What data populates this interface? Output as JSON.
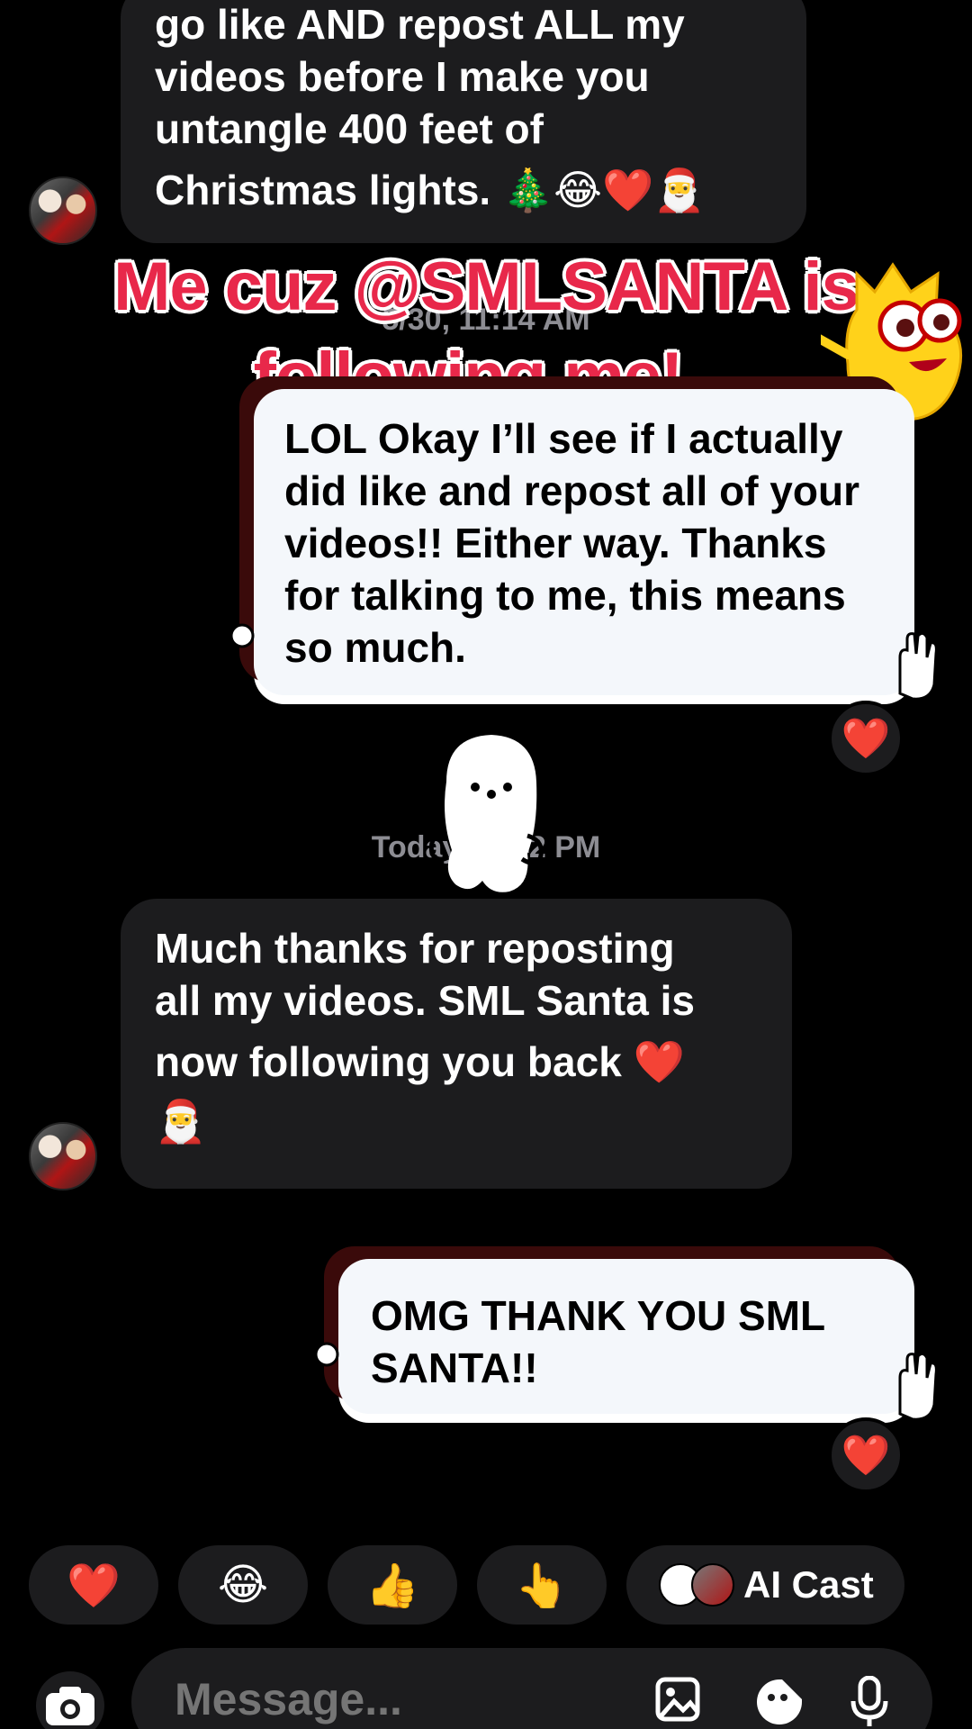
{
  "messages": {
    "msg1_lines": [
      "go like AND repost ALL my",
      "videos before I make you",
      "untangle 400 feet of",
      "Christmas lights. 🎄😂❤️🎅"
    ],
    "timestamp1": "5/30, 11:14 AM",
    "msg2": "LOL Okay I’ll see if I actually did like and repost all of your videos!! Either way. Thanks for talking to me, this means so much.",
    "timestamp2": "Today 12:42 PM",
    "msg3_lines": [
      "Much thanks for reposting",
      "all my videos. SML Santa is",
      "now following you back ❤️",
      "🎅"
    ],
    "msg4": "OMG THANK YOU SML SANTA!!"
  },
  "overlay": {
    "caption_line1": "Me cuz @SMLSANTA is",
    "caption_line2": "following me!"
  },
  "reactions": {
    "heart": "❤️"
  },
  "quick_reacts": {
    "r1": "❤️",
    "r2": "😂",
    "r3": "👍",
    "r4": "👆",
    "ai_label": "AI Cast"
  },
  "composer": {
    "placeholder": "Message..."
  },
  "colors": {
    "background": "#000000",
    "incoming_bubble": "#1c1c1e",
    "outgoing_bubble": "#f4f7fb",
    "caption": "#e8284a",
    "heart": "#ff1a3d"
  }
}
